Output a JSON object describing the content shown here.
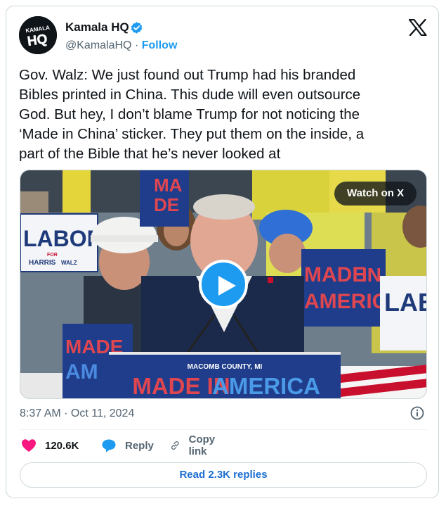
{
  "author": {
    "name": "Kamala HQ",
    "handle": "@KamalaHQ",
    "separator": "·",
    "follow_label": "Follow",
    "avatar_text_top": "KAMALA",
    "avatar_text_main": "HQ",
    "verified_icon": "verified-badge-icon",
    "brand_color": "#1d9bf0"
  },
  "tweet": {
    "text": "Gov. Walz: We just found out Trump had his branded\nBibles printed in China. This dude will even outsource\nGod. But hey, I don’t blame Trump for not noticing the\n‘Made in China’ sticker. They put them on the inside, a\npart of the Bible that he’s never looked at"
  },
  "media": {
    "watch_label": "Watch on X",
    "signs": {
      "labor": "LABOR",
      "for": "FOR",
      "harris": "HARRIS",
      "walz": "WALZ",
      "made": "MADE",
      "in": "IN",
      "america": "AMERICA",
      "made_short": "MA",
      "de_short": "DE",
      "am_short": "AM",
      "lab_short": "LAB",
      "podium_county": "MACOMB COUNTY, MI",
      "podium_made_in": "MADE IN",
      "podium_america": "AMERICA"
    }
  },
  "meta": {
    "time": "8:37 AM",
    "separator": " · ",
    "date": "Oct 11, 2024"
  },
  "actions": {
    "like_count": "120.6K",
    "reply_label": "Reply",
    "copy_label": "Copy link"
  },
  "replies_button": "Read 2.3K replies"
}
